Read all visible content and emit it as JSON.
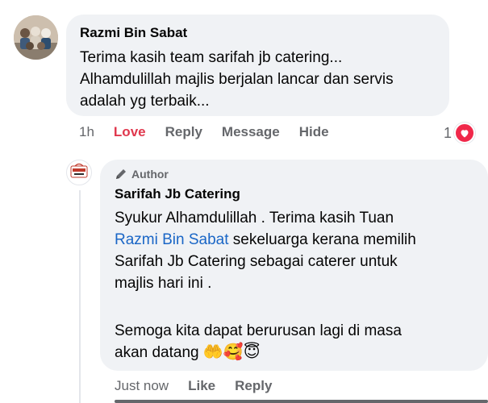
{
  "comment": {
    "author": "Razmi Bin Sabat",
    "text_lines": [
      "Terima kasih team sarifah jb catering...",
      "Alhamdulillah majlis berjalan lancar dan servis",
      "adalah yg terbaik..."
    ],
    "time": "1h",
    "actions": {
      "love": "Love",
      "reply": "Reply",
      "message": "Message",
      "hide": "Hide"
    },
    "reaction_count": "1",
    "reaction_icon": "heart-icon"
  },
  "reply": {
    "badge": "Author",
    "badge_icon": "pen-icon",
    "author": "Sarifah Jb Catering",
    "line1": "Syukur Alhamdulillah . Terima kasih Tuan",
    "mention": "Razmi Bin Sabat",
    "line2_rest": " sekeluarga kerana memilih",
    "line3": "Sarifah Jb Catering sebagai caterer untuk",
    "line4": "majlis hari ini .",
    "line5": "Semoga kita dapat berurusan lagi di masa",
    "line6": "akan datang ",
    "emojis": [
      "🤲",
      "🥰",
      "😇"
    ],
    "time": "Just now",
    "actions": {
      "like": "Like",
      "reply": "Reply"
    }
  },
  "colors": {
    "accent_love": "#e0384e",
    "mention": "#1a66c6",
    "muted": "#65676b"
  }
}
